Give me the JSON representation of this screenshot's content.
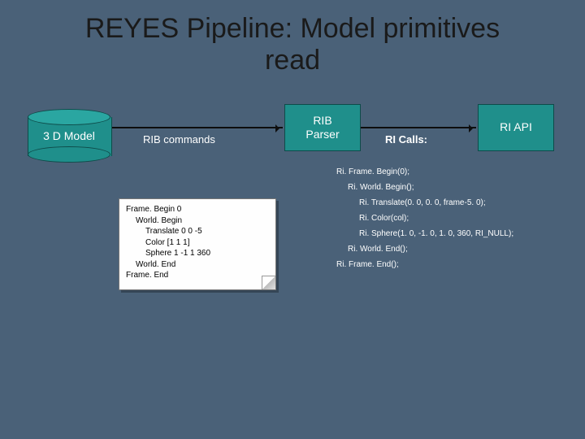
{
  "title_line1": "REYES Pipeline: Model primitives",
  "title_line2": "read",
  "nodes": {
    "model": "3 D Model",
    "parser": "RIB\nParser",
    "api": "RI API"
  },
  "edges": {
    "rib_commands": "RIB commands",
    "ri_calls": "RI Calls:"
  },
  "rib_snippet": [
    {
      "indent": 1,
      "text": "Frame. Begin 0"
    },
    {
      "indent": 2,
      "text": "World. Begin"
    },
    {
      "indent": 3,
      "text": "Translate 0 0 -5"
    },
    {
      "indent": 3,
      "text": "Color [1 1 1]"
    },
    {
      "indent": 3,
      "text": "Sphere 1 -1 1 360"
    },
    {
      "indent": 2,
      "text": "World. End"
    },
    {
      "indent": 1,
      "text": "Frame. End"
    }
  ],
  "ri_calls": [
    {
      "indent": 1,
      "text": "Ri. Frame. Begin(0);"
    },
    {
      "indent": 2,
      "text": "Ri. World. Begin();"
    },
    {
      "indent": 3,
      "text": "Ri. Translate(0. 0, 0. 0, frame-5. 0);"
    },
    {
      "indent": 3,
      "text": "Ri. Color(col);"
    },
    {
      "indent": 3,
      "text": "Ri. Sphere(1. 0, -1. 0, 1. 0, 360, RI_NULL);"
    },
    {
      "indent": 2,
      "text": "Ri. World. End();"
    },
    {
      "indent": 1,
      "text": "Ri. Frame. End();"
    }
  ]
}
